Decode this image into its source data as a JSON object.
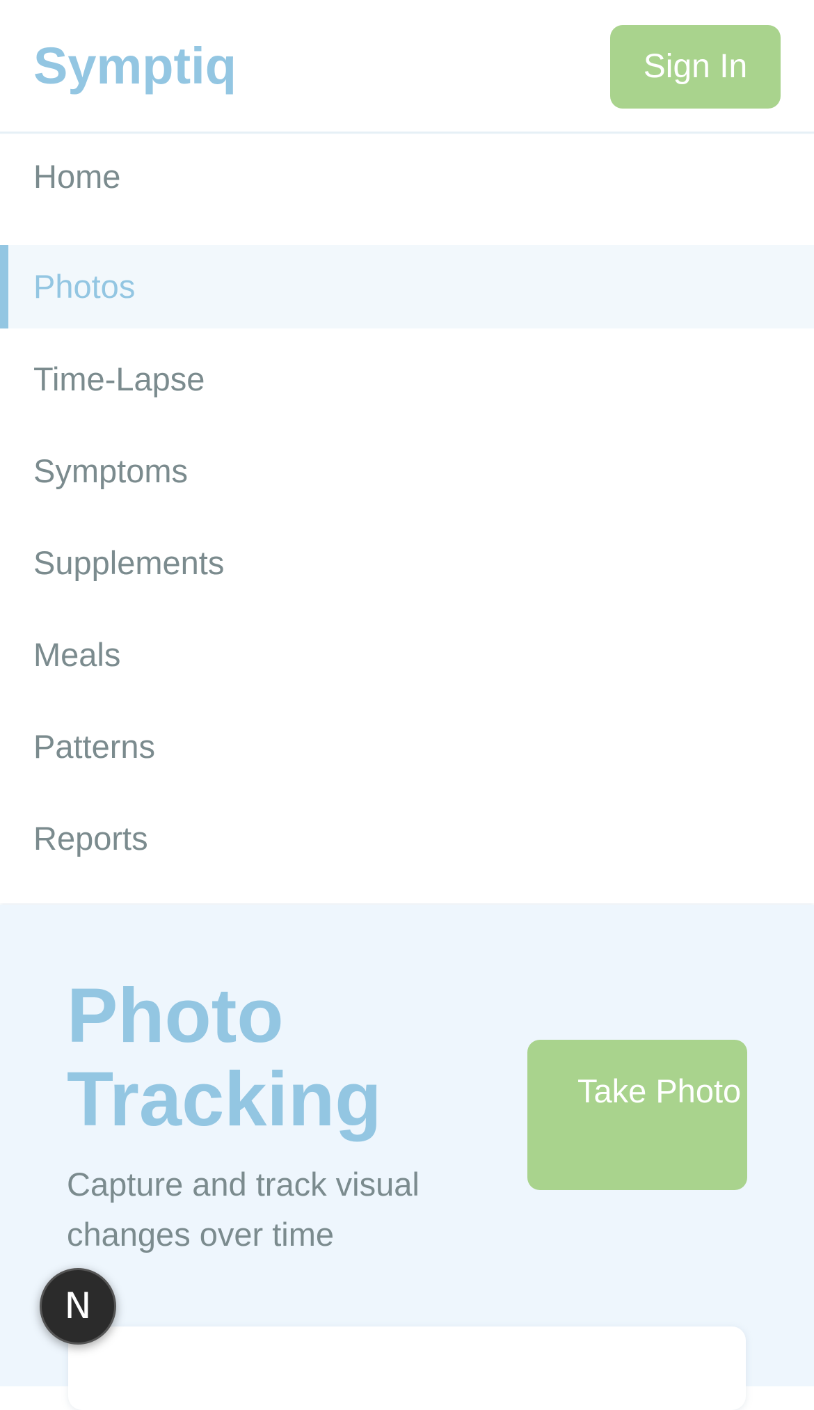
{
  "header": {
    "logo": "Symptiq",
    "signin_label": "Sign In"
  },
  "nav": {
    "items": [
      {
        "label": "Home",
        "active": false
      },
      {
        "label": "Photos",
        "active": true
      },
      {
        "label": "Time-Lapse",
        "active": false
      },
      {
        "label": "Symptoms",
        "active": false
      },
      {
        "label": "Supplements",
        "active": false
      },
      {
        "label": "Meals",
        "active": false
      },
      {
        "label": "Patterns",
        "active": false
      },
      {
        "label": "Reports",
        "active": false
      }
    ]
  },
  "hero": {
    "title": "Photo Tracking",
    "subtitle": "Capture and track visual changes over time",
    "button_label": "Take Photo"
  },
  "dev_badge": {
    "letter": "N"
  },
  "colors": {
    "brand": "#93c6e2",
    "accent_button": "#a9d38d",
    "text_muted": "#7b8b8e",
    "hero_bg": "#eef6fd"
  }
}
